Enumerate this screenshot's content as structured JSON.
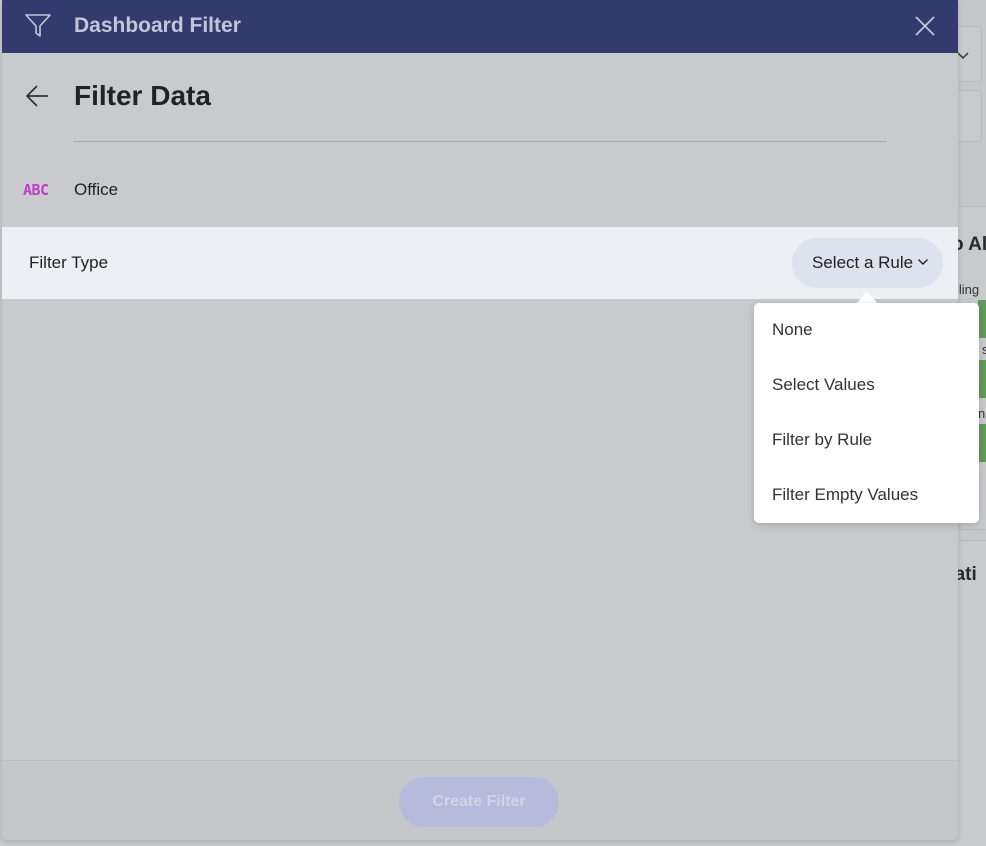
{
  "header": {
    "title": "Dashboard Filter"
  },
  "page": {
    "title": "Filter Data"
  },
  "field": {
    "type_badge": "ABC",
    "name": "Office"
  },
  "filter_row": {
    "label": "Filter Type",
    "selected_rule": "Select a Rule"
  },
  "dropdown": {
    "options": [
      "None",
      "Select Values",
      "Filter by Rule",
      "Filter Empty Values"
    ]
  },
  "footer": {
    "create_button": "Create Filter"
  },
  "background": {
    "fragment_1": "o Al",
    "fragment_2": "iling",
    "fragment_3": "cati",
    "fragment_4": "s",
    "fragment_5": "n"
  },
  "colors": {
    "header_bg": "#323a6e",
    "field_type_badge": "#c23fc9",
    "filter_row_bg": "#eeeff4",
    "select_pill_bg": "#dee1ee",
    "create_button_disabled": "#b6bbdc"
  }
}
